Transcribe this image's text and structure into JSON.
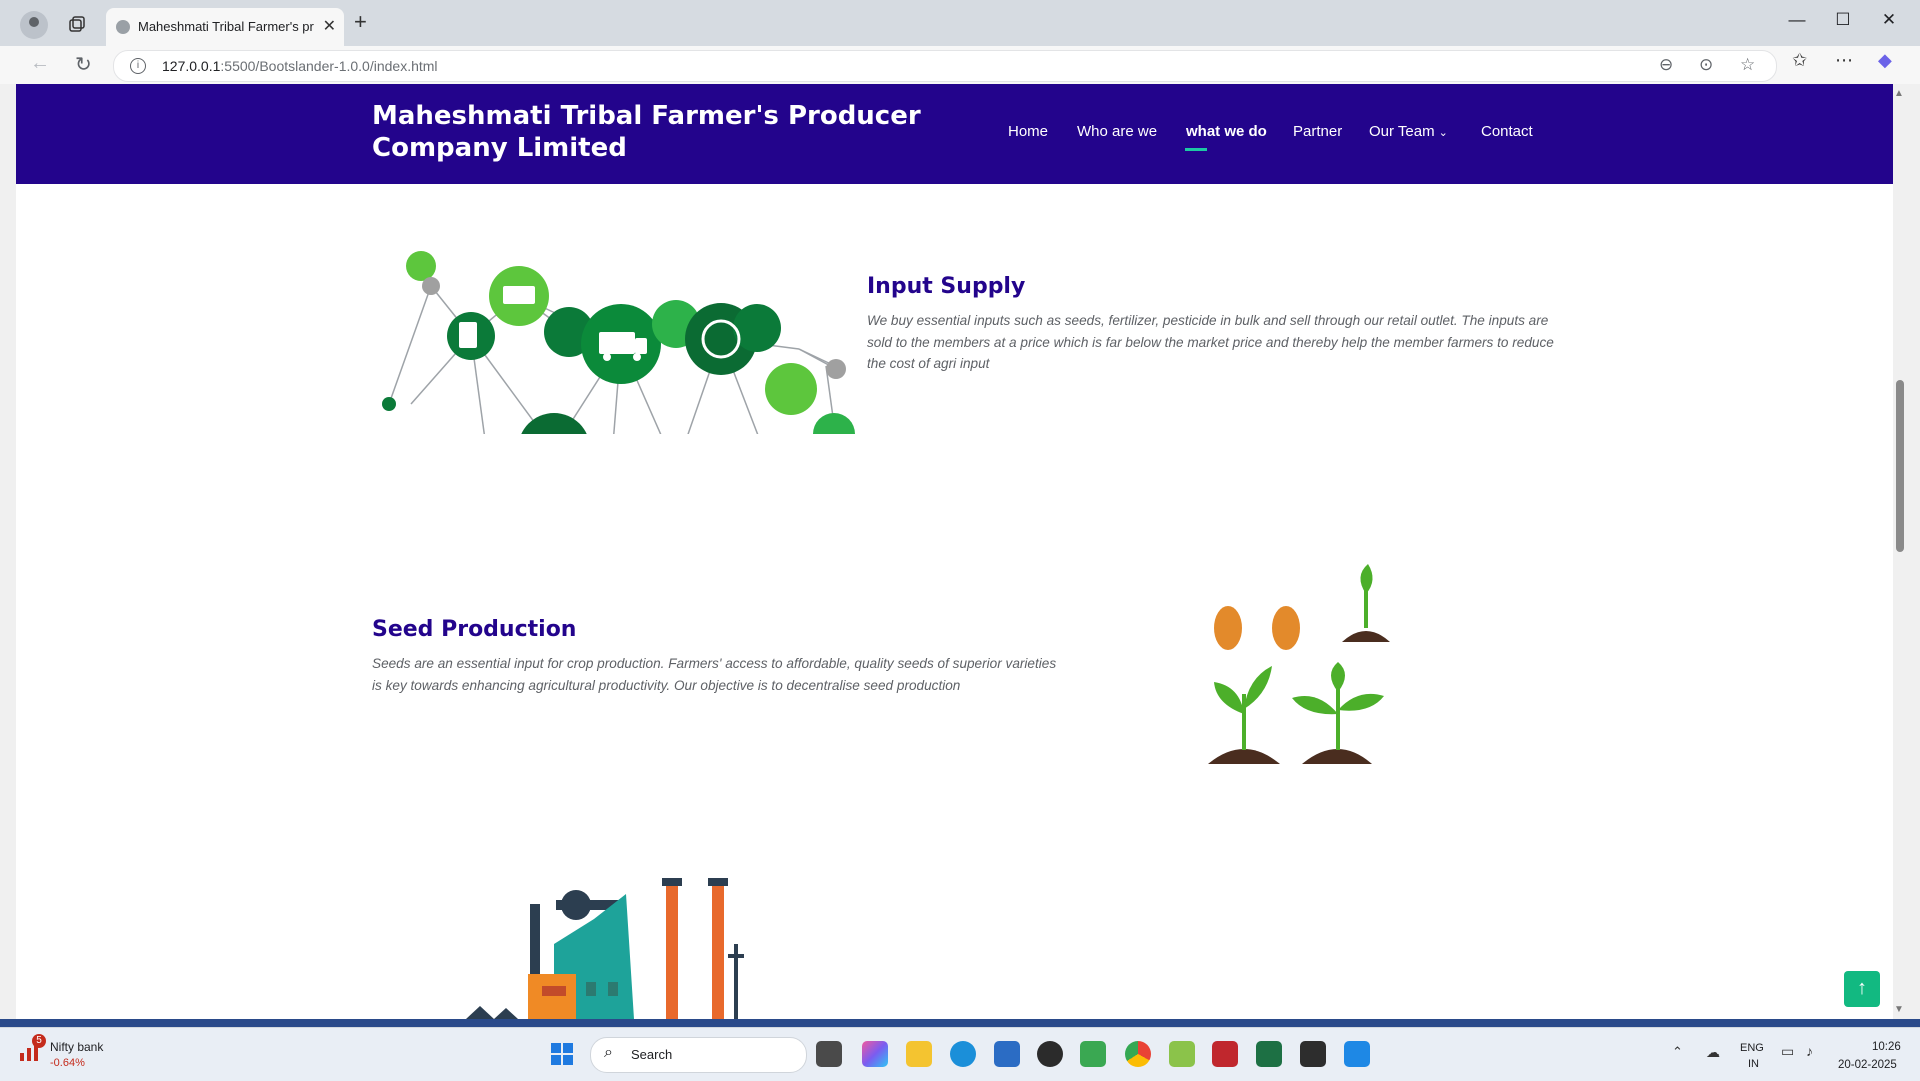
{
  "browser": {
    "tab_title": "Maheshmati Tribal Farmer's prod",
    "url_host": "127.0.0.1",
    "url_path": ":5500/Bootslander-1.0.0/index.html"
  },
  "site": {
    "logo": "Maheshmati Tribal Farmer's Producer Company Limited",
    "nav": {
      "home": "Home",
      "who": "Who are we",
      "what": "what we do",
      "partner": "Partner",
      "team": "Our Team",
      "contact": "Contact"
    },
    "active_nav": "what we do",
    "accent_color": "#23048c",
    "underline_color": "#1dc8a4"
  },
  "sections": {
    "input_supply": {
      "title": "Input Supply",
      "text": "We buy essential inputs such as seeds, fertilizer, pesticide in bulk and sell through our retail outlet. The inputs are sold to the members at a price which is far below the market price and thereby help the member farmers to reduce the cost of agri input"
    },
    "seed_production": {
      "title": "Seed Production",
      "text": "Seeds are an essential input for crop production. Farmers' access to affordable, quality seeds of superior varieties is key towards enhancing agricultural productivity. Our objective is to decentralise seed production"
    }
  },
  "taskbar": {
    "widget_badge": "5",
    "widget_name": "Nifty bank",
    "widget_change": "-0.64%",
    "search_label": "Search",
    "lang_line1": "ENG",
    "lang_line2": "IN",
    "time": "10:26",
    "date": "20-02-2025"
  },
  "icons": {
    "back_to_top": "arrow-up-icon",
    "back_to_top_color": "#12b981"
  }
}
